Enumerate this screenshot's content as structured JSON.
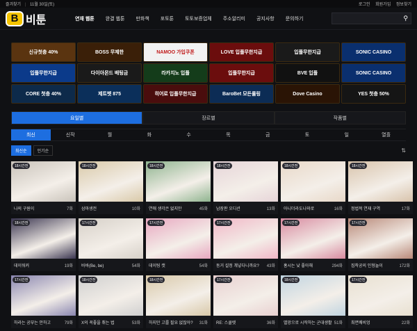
{
  "topbar": {
    "left1": "즐겨찾기",
    "left2": "11월 30일(토)",
    "login": "로그인",
    "signup": "회원가입",
    "info": "정보찾기"
  },
  "logo": {
    "mark": "B",
    "text": "비툰"
  },
  "menu": [
    "연재 웹툰",
    "완결 웹툰",
    "만화책",
    "포토툰",
    "토토보증업체",
    "주소알리미",
    "공지사항",
    "문의하기"
  ],
  "banners": [
    "신규첫충 40%",
    "BOSS 무제한",
    "NAMOO 가입쿠폰",
    "LOVE 입플무한지급",
    "입플무한지급",
    "SONIC CASINO",
    "입플무한지급",
    "다이아몬드 배팅금",
    "라카지노 입플",
    "입플무한지급",
    "BVE 입플",
    "SONIC CASINO",
    "CORE 첫충 40%",
    "제트벳 875",
    "히어로 입플무한지급",
    "BaroBet 모든롤링",
    "Dove Casino",
    "YES 첫충 50%"
  ],
  "banner_colors": [
    "#5a3410",
    "#3a1f08",
    "#f2f2f2",
    "#6b0d0d",
    "#1a1a1a",
    "#0a2f6e",
    "#0b3a8a",
    "#1a1a1a",
    "#143c1a",
    "#6b0d0d",
    "#111",
    "#0a2f6e",
    "#0d2a4a",
    "#0b2f5a",
    "#4a0d0d",
    "#0c2c55",
    "#2a1405",
    "#151515"
  ],
  "tabs1": [
    "요일별",
    "장르별",
    "작품별"
  ],
  "tabs2": [
    "최신",
    "신작",
    "월",
    "화",
    "수",
    "목",
    "금",
    "토",
    "일",
    "열흘"
  ],
  "sort": [
    "최신순",
    "인기순"
  ],
  "cards": [
    {
      "badge": "18시간전",
      "title": "나의 구원이",
      "count": "7화",
      "color": "#c9c3ba"
    },
    {
      "badge": "18시간전",
      "title": "삼마생전",
      "count": "10화",
      "color": "#d9c9a8"
    },
    {
      "badge": "18시간전",
      "title": "연애 생각은 없지만",
      "count": "45화",
      "color": "#8fb48f"
    },
    {
      "badge": "18시간전",
      "title": "남장판 오디션",
      "count": "13화",
      "color": "#e6d4d8"
    },
    {
      "badge": "18시간전",
      "title": "아니더라도나와로",
      "count": "16화",
      "color": "#e8d8c8"
    },
    {
      "badge": "18시간전",
      "title": "정법적 연재 구역",
      "count": "17화",
      "color": "#d8c3ab"
    },
    {
      "badge": "18시간전",
      "title": "데이워커",
      "count": "19화",
      "color": "#3a3550"
    },
    {
      "badge": "17시간전",
      "title": "바바(Be, be)",
      "count": "54화",
      "color": "#d6d0c8"
    },
    {
      "badge": "17시간전",
      "title": "데이팅 캣",
      "count": "54화",
      "color": "#e8a7c0"
    },
    {
      "badge": "17시간전",
      "title": "동거 설정 걔넣다니까요?",
      "count": "43화",
      "color": "#f0b6c6"
    },
    {
      "badge": "17시간전",
      "title": "홍시는 낮 좋아해",
      "count": "294화",
      "color": "#d88aa0"
    },
    {
      "badge": "17시간전",
      "title": "집착공의 인형놀이",
      "count": "172화",
      "color": "#b88878"
    },
    {
      "badge": "17시간전",
      "title": "하라는 공부는 안하고",
      "count": "79화",
      "color": "#8a86b0"
    },
    {
      "badge": "18시간전",
      "title": "X의 꼭좋을 취는 법",
      "count": "53화",
      "color": "#cfcfcf"
    },
    {
      "badge": "18시간전",
      "title": "하지만 고를 필요 없잖아?",
      "count": "31화",
      "color": "#d8c8a8"
    },
    {
      "badge": "17시간전",
      "title": "RE: 스쿨렛",
      "count": "36화",
      "color": "#e8d0d0"
    },
    {
      "badge": "18시간전",
      "title": "멸망으로 시작하는 군대생활",
      "count": "51화",
      "color": "#c0d4e0"
    },
    {
      "badge": "17시간전",
      "title": "최면쾌비엉",
      "count": "22화",
      "color": "#e8e0d0"
    }
  ]
}
